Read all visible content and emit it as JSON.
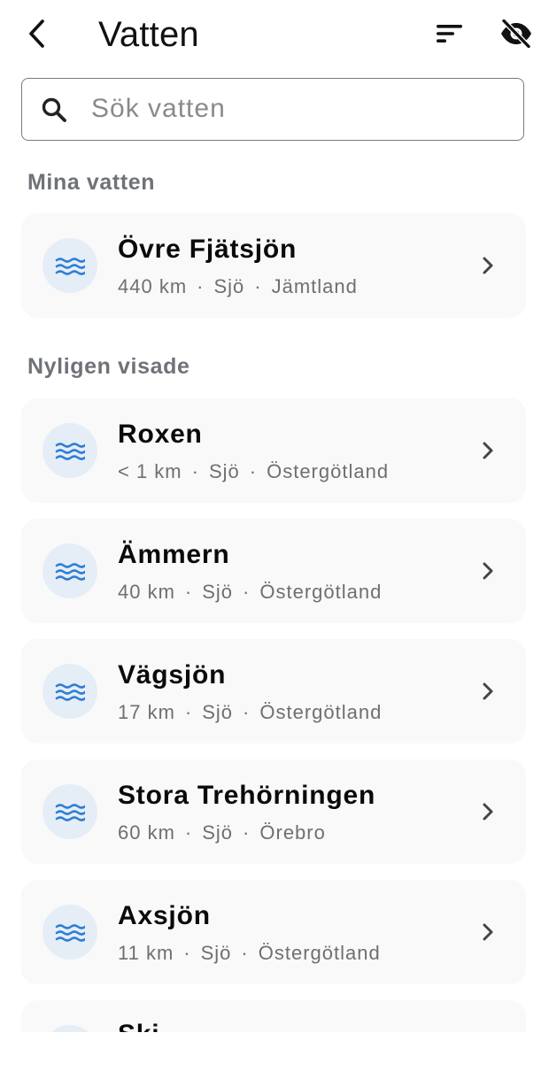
{
  "header": {
    "title": "Vatten",
    "back_icon": "chevron-left-icon",
    "sort_icon": "sort-icon",
    "hide_icon": "eye-off-icon"
  },
  "search": {
    "placeholder": "Sök vatten",
    "value": "",
    "icon": "search-icon"
  },
  "sections": {
    "mine": {
      "heading": "Mina vatten",
      "items": [
        {
          "name": "Övre Fjätsjön",
          "distance": "440 km",
          "type": "Sjö",
          "region": "Jämtland"
        }
      ]
    },
    "recent": {
      "heading": "Nyligen visade",
      "items": [
        {
          "name": "Roxen",
          "distance": "< 1 km",
          "type": "Sjö",
          "region": "Östergötland"
        },
        {
          "name": "Ämmern",
          "distance": "40 km",
          "type": "Sjö",
          "region": "Östergötland"
        },
        {
          "name": "Vägsjön",
          "distance": "17 km",
          "type": "Sjö",
          "region": "Östergötland"
        },
        {
          "name": "Stora Trehörningen",
          "distance": "60 km",
          "type": "Sjö",
          "region": "Örebro"
        },
        {
          "name": "Axsjön",
          "distance": "11 km",
          "type": "Sjö",
          "region": "Östergötland"
        },
        {
          "name": "Ski",
          "distance": "",
          "type": "",
          "region": ""
        }
      ]
    }
  },
  "separator": "·",
  "colors": {
    "accent": "#2f7fd3",
    "badge_bg": "#e5edf6",
    "card_bg": "#f9f9f9",
    "heading": "#6f7378"
  }
}
